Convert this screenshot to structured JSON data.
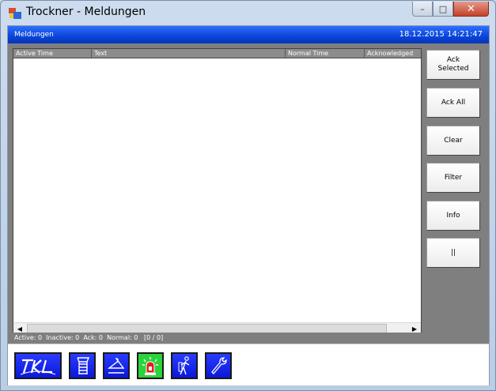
{
  "window": {
    "title": "Trockner - Meldungen"
  },
  "header": {
    "title": "Meldungen",
    "datetime": "18.12.2015 14:21:47"
  },
  "list": {
    "columns": [
      "Active Time",
      "Text",
      "Normal Time",
      "Acknowledged"
    ]
  },
  "buttons": {
    "ack_selected": "Ack\nSelected",
    "ack_all": "Ack All",
    "clear": "Clear",
    "filter": "Filter",
    "info": "Info",
    "pause": "||"
  },
  "status": {
    "text": "Active: 0  Inactive: 0  Ack: 0  Normal: 0   [0 / 0]"
  },
  "toolbar": {
    "logo_icon": "tkl-logo-icon",
    "tool_icons": [
      "rack-icon",
      "hanger-icon",
      "alarm-icon",
      "person-icon",
      "wrench-icon"
    ],
    "active_color": "#2bd43a",
    "tool_color": "#0a18d8"
  },
  "colors": {
    "header": "#0a44d8",
    "panel": "#7f7f7f",
    "close_button": "#c5412a"
  }
}
